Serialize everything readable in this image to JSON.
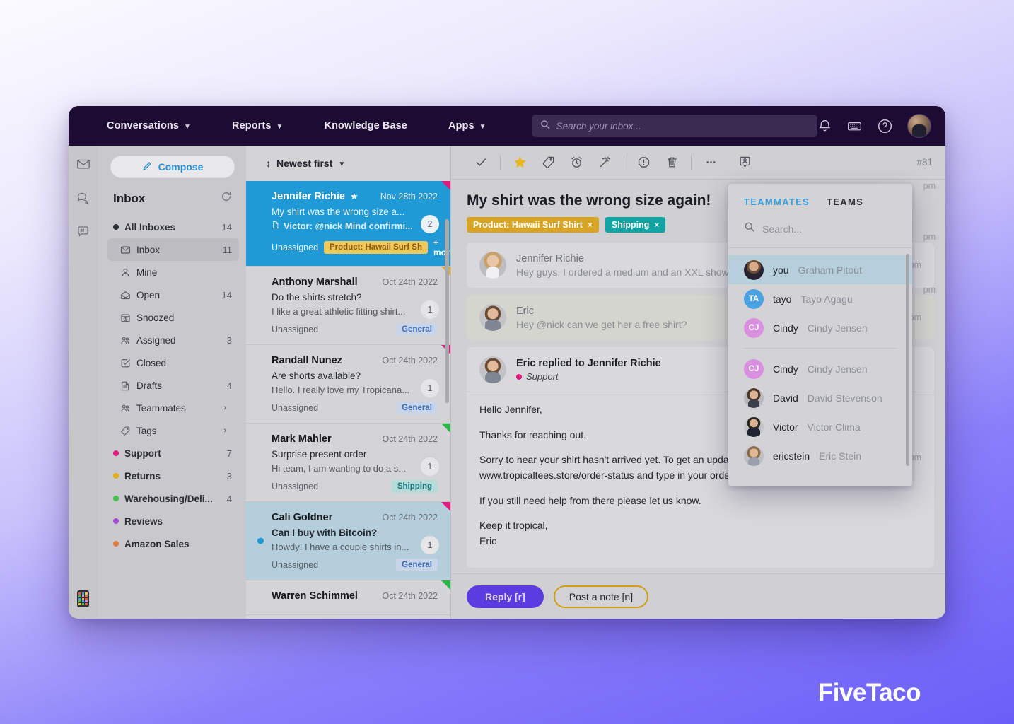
{
  "topnav": {
    "items": [
      {
        "label": "Conversations",
        "caret": true
      },
      {
        "label": "Reports",
        "caret": true
      },
      {
        "label": "Knowledge Base",
        "caret": false
      },
      {
        "label": "Apps",
        "caret": true
      }
    ],
    "search_placeholder": "Search your inbox...",
    "search_value": "",
    "icons": [
      "bell-icon",
      "keyboard-icon",
      "help-icon",
      "user-avatar"
    ]
  },
  "rail": {
    "icons": [
      "mail-icon",
      "chat-icon",
      "hashtag-chat-icon",
      "apps-grid-icon"
    ]
  },
  "sidebar": {
    "compose_label": "Compose",
    "title": "Inbox",
    "items": [
      {
        "label": "All Inboxes",
        "count": "14",
        "icon": "dot",
        "dot_color": "#2a2d34",
        "bold": true,
        "sub": false,
        "active": false
      },
      {
        "label": "Inbox",
        "count": "11",
        "icon": "inbox-icon",
        "bold": false,
        "sub": true,
        "active": true
      },
      {
        "label": "Mine",
        "count": "",
        "icon": "person-icon",
        "bold": false,
        "sub": true,
        "active": false
      },
      {
        "label": "Open",
        "count": "14",
        "icon": "open-envelope-icon",
        "bold": false,
        "sub": true,
        "active": false
      },
      {
        "label": "Snoozed",
        "count": "",
        "icon": "clock-icon",
        "bold": false,
        "sub": true,
        "active": false
      },
      {
        "label": "Assigned",
        "count": "3",
        "icon": "people-icon",
        "bold": false,
        "sub": true,
        "active": false
      },
      {
        "label": "Closed",
        "count": "",
        "icon": "check-box-icon",
        "bold": false,
        "sub": true,
        "active": false
      },
      {
        "label": "Drafts",
        "count": "4",
        "icon": "document-icon",
        "bold": false,
        "sub": true,
        "active": false
      },
      {
        "label": "Teammates",
        "count": "",
        "icon": "people-icon",
        "chevron": "›",
        "bold": false,
        "sub": true,
        "active": false
      },
      {
        "label": "Tags",
        "count": "",
        "icon": "tag-icon",
        "chevron": "›",
        "bold": false,
        "sub": true,
        "active": false
      },
      {
        "label": "Support",
        "count": "7",
        "icon": "dot",
        "dot_color": "#e2197e",
        "bold": true,
        "sub": false,
        "active": false
      },
      {
        "label": "Returns",
        "count": "3",
        "icon": "dot",
        "dot_color": "#e3ad1a",
        "bold": true,
        "sub": false,
        "active": false
      },
      {
        "label": "Warehousing/Deli...",
        "count": "4",
        "icon": "dot",
        "dot_color": "#3fc14b",
        "bold": true,
        "sub": false,
        "active": false
      },
      {
        "label": "Reviews",
        "count": "",
        "icon": "dot",
        "dot_color": "#a04bd6",
        "bold": true,
        "sub": false,
        "active": false
      },
      {
        "label": "Amazon Sales",
        "count": "",
        "icon": "dot",
        "dot_color": "#e07a3a",
        "bold": true,
        "sub": false,
        "active": false
      }
    ]
  },
  "convlist": {
    "sort_label": "Newest first",
    "items": [
      {
        "name": "Jennifer Richie",
        "starred": true,
        "date": "Nov 28th 2022",
        "subject": "My shirt was the wrong size a...",
        "preview": "Victor: @nick Mind confirmi...",
        "preview_icon": "note-icon",
        "assignee": "Unassigned",
        "tag": "Product: Hawaii Surf Sh",
        "tag_type": "product",
        "more": "+ more",
        "count": "2",
        "corner": "pink",
        "state": "selected",
        "unread": false
      },
      {
        "name": "Anthony Marshall",
        "starred": false,
        "date": "Oct 24th 2022",
        "subject": "Do the shirts stretch?",
        "preview": "I like a great athletic fitting shirt...",
        "preview_icon": "",
        "assignee": "Unassigned",
        "tag": "General",
        "tag_type": "general",
        "more": "",
        "count": "1",
        "corner": "yellow",
        "state": "",
        "unread": false
      },
      {
        "name": "Randall Nunez",
        "starred": false,
        "date": "Oct 24th 2022",
        "subject": "Are shorts available?",
        "preview": "Hello. I really love my Tropicana...",
        "preview_icon": "",
        "assignee": "Unassigned",
        "tag": "General",
        "tag_type": "general",
        "more": "",
        "count": "1",
        "corner": "pink",
        "state": "",
        "unread": false
      },
      {
        "name": "Mark Mahler",
        "starred": false,
        "date": "Oct 24th 2022",
        "subject": "Surprise present order",
        "preview": "Hi team, I am wanting to do a s...",
        "preview_icon": "",
        "assignee": "Unassigned",
        "tag": "Shipping",
        "tag_type": "shipping",
        "more": "",
        "count": "1",
        "corner": "green",
        "state": "",
        "unread": false
      },
      {
        "name": "Cali Goldner",
        "starred": false,
        "date": "Oct 24th 2022",
        "subject": "Can I buy with Bitcoin?",
        "preview": "Howdy! I have a couple shirts in...",
        "preview_icon": "",
        "assignee": "Unassigned",
        "tag": "General",
        "tag_type": "general",
        "more": "",
        "count": "1",
        "corner": "pink",
        "state": "unread-sel",
        "unread": true
      },
      {
        "name": "Warren Schimmel",
        "starred": false,
        "date": "Oct 24th 2022",
        "subject": "",
        "preview": "",
        "preview_icon": "",
        "assignee": "",
        "tag": "",
        "tag_type": "",
        "more": "",
        "count": "",
        "corner": "green",
        "state": "",
        "unread": false
      }
    ]
  },
  "main": {
    "toolbar_icons": [
      "check-icon",
      "star-icon",
      "tag-icon",
      "snooze-icon",
      "magic-wand-icon",
      "alert-icon",
      "trash-icon",
      "more-icon",
      "assign-icon"
    ],
    "ticket_id": "#81",
    "subject": "My shirt was the wrong size again!",
    "tags": [
      {
        "label": "Product: Hawaii Surf Shirt",
        "color": "#d8a426",
        "close": "×"
      },
      {
        "label": "Shipping",
        "color": "#12a3a3",
        "close": "×"
      }
    ],
    "messages": [
      {
        "type": "collapsed",
        "name": "Jennifer Richie",
        "preview": "Hey guys, I ordered a medium and an XXL showe",
        "timestamp": "pm",
        "note": false
      },
      {
        "type": "collapsed",
        "name": "Eric",
        "preview": "Hey @nick can we get her a free shirt?",
        "timestamp": "pm",
        "note": true
      }
    ],
    "open_message": {
      "header": "Eric replied to Jennifer Richie",
      "category": "Support",
      "category_color": "#e2197e",
      "timestamp": "pm",
      "paragraphs": [
        "Hello Jennifer,",
        "Thanks for reaching out.",
        "Sorry to hear your shirt hasn't arrived yet.  To get an update on the status, please visit www.tropicaltees.store/order-status and type in your order number.",
        "If you still need help from there please let us know.",
        "Keep it tropical,",
        "Eric"
      ]
    },
    "reply_label": "Reply [r]",
    "note_label": "Post a note [n]"
  },
  "popup": {
    "tabs": [
      {
        "label": "TEAMMATES",
        "active": true
      },
      {
        "label": "TEAMS",
        "active": false
      }
    ],
    "search_placeholder": "Search...",
    "search_value": "",
    "top_group": [
      {
        "handle": "you",
        "full": "Graham Pitout",
        "avatar_type": "photo-f",
        "initials": "",
        "selected": true
      },
      {
        "handle": "tayo",
        "full": "Tayo Agagu",
        "avatar_type": "blue",
        "initials": "TA",
        "selected": false
      },
      {
        "handle": "Cindy",
        "full": "Cindy Jensen",
        "avatar_type": "pink",
        "initials": "CJ",
        "selected": false
      }
    ],
    "bottom_group": [
      {
        "handle": "Cindy",
        "full": "Cindy Jensen",
        "avatar_type": "pink",
        "initials": "CJ",
        "selected": false
      },
      {
        "handle": "David",
        "full": "David Stevenson",
        "avatar_type": "photo-m",
        "initials": "",
        "selected": false
      },
      {
        "handle": "Victor",
        "full": "Victor Clima",
        "avatar_type": "photo-s",
        "initials": "",
        "selected": false
      },
      {
        "handle": "ericstein",
        "full": "Eric Stein",
        "avatar_type": "photo-e",
        "initials": "",
        "selected": false
      }
    ]
  },
  "brand": {
    "name": "FiveTaco"
  }
}
